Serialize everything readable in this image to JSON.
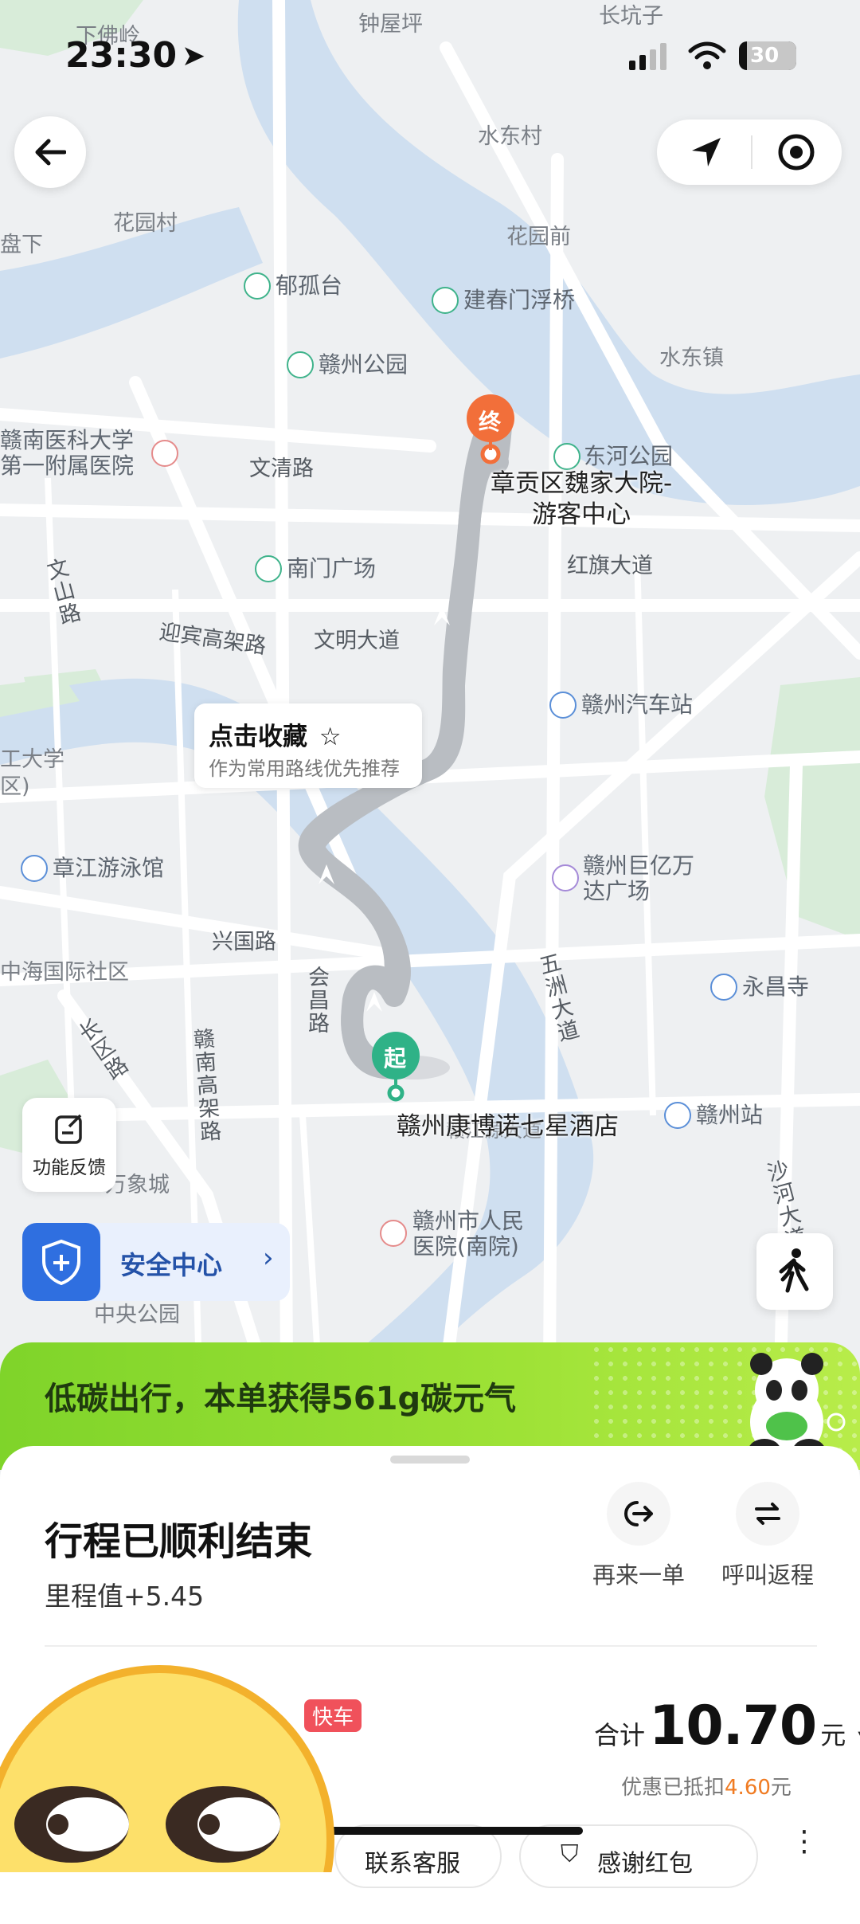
{
  "status_bar": {
    "time": "23:30",
    "battery": "30"
  },
  "map": {
    "labels": {
      "xiafoling": "下佛岭",
      "zhongwuping": "钟屋坪",
      "changkengzi": "长坑子",
      "shuidongcun": "水东村",
      "huayuancun": "花园村",
      "panxia": "盘下",
      "huayuanqian": "花园前",
      "shuidongzhen": "水东镇",
      "wenqinglu": "文清路",
      "honqidadao": "红旗大道",
      "wenshanlu": "文山路",
      "yingbingaojia": "迎宾高架路",
      "wenmingdadao": "文明大道",
      "xingguolu": "兴国路",
      "huichanglu": "会昌路",
      "gannangaojia": "赣南高架路",
      "changqulu": "长区路",
      "wuzhoudadao": "五洲大道",
      "shahedadao": "沙河大道",
      "gangjiangyuan": "赣江源大道",
      "zhonghai": "中海国际社区",
      "gonglida": "工大学",
      "gonglida2": "区)",
      "wanxiang": "万象城",
      "zhongyanggongyuan": "中央公园"
    },
    "pois": {
      "yugutai": "郁孤台",
      "jianchunmen": "建春门浮桥",
      "ganzhougongyuan": "赣州公园",
      "dongheggongyuan": "东河公园",
      "nanmenguangchang": "南门广场",
      "yixueyuan_1": "赣南医科大学",
      "yixueyuan_2": "第一附属医院",
      "qichezhan": "赣州汽车站",
      "zhangjiang": "章江游泳馆",
      "juyiwan_1": "赣州巨亿万",
      "juyiwan_2": "达广场",
      "yongchangsi": "永昌寺",
      "ganzhouzhan": "赣州站",
      "renminyiyuan_1": "赣州市人民",
      "renminyiyuan_2": "医院(南院)"
    },
    "route": {
      "end_marker": "终",
      "start_marker": "起",
      "end_name_1": "章贡区魏家大院-",
      "end_name_2": "游客中心",
      "start_name": "赣州康博诺七星酒店"
    },
    "favorite_tip": {
      "title": "点击收藏",
      "subtitle": "作为常用路线优先推荐"
    },
    "feedback_label": "功能反馈",
    "safety_center_label": "安全中心"
  },
  "eco_banner": {
    "text": "低碳出行，本单获得561g碳元气"
  },
  "trip": {
    "title": "行程已顺利结束",
    "mileage": "里程值+5.45",
    "reorder_label": "再来一单",
    "return_label": "呼叫返程",
    "car_type": "快车",
    "total_prefix": "合计",
    "total_amount": "10.70",
    "currency": "元",
    "discount_prefix": "优惠已抵扣",
    "discount_amount": "4.60",
    "discount_suffix": "元",
    "contact_service": "联系客服",
    "thank_tip": "感谢红包"
  },
  "colors": {
    "route": "#b9bdc2",
    "end": "#f26f3a",
    "start": "#2fb287",
    "accent_green": "#8bdc2e",
    "safety_blue": "#2f6fe0",
    "price_orange": "#f07b22"
  }
}
